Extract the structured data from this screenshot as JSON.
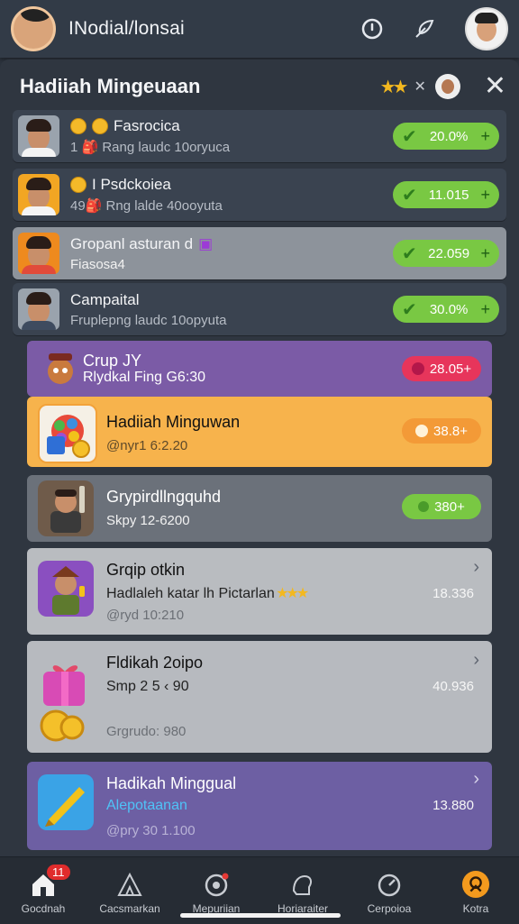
{
  "app": {
    "title": "INodial/lonsai"
  },
  "panel": {
    "title": "Hadiiah Mingeuaan",
    "close_icon": "close-icon"
  },
  "leaderboard": [
    {
      "name": "Fasrocica",
      "sub": "1 🎒 Rang laudc 10oryuca",
      "value": "20.0%",
      "photo_bg": "#9aa3ad",
      "shirt": "#f3f3f3"
    },
    {
      "name": "I Psdckoiea",
      "sub": "49🎒 Rng lalde 40ooyuta",
      "value": "11.015",
      "photo_bg": "#f2a623",
      "shirt": "#ffffff"
    },
    {
      "name": "Gropanl asturan d",
      "sub": "Fiasosa4",
      "value": "22.059",
      "photo_bg": "#ee8a1e",
      "shirt": "#e14b3a"
    },
    {
      "name": "Campaital",
      "sub": "Fruplepng laudc 10opyuta",
      "value": "30.0%",
      "photo_bg": "#9aa3ad",
      "shirt": "#3e4b5f"
    }
  ],
  "cards": [
    {
      "title": "Crup  JY",
      "sub": "Rlydkal Fing G6:30",
      "pill": "28.05+"
    },
    {
      "title": "Hadiiah Minguwan",
      "foot": "@nyr1 6:2.20",
      "pill": "38.8+"
    },
    {
      "title": "Grypirdllngquhd",
      "foot": "Skpy 12-6200",
      "pill": "380+"
    },
    {
      "title": "Grqip  otkin",
      "sub": "Hadlaleh katar lh Pictarlan",
      "foot": "@ryd 10:210",
      "value": "18.336"
    },
    {
      "title": "Fldikah 2oipo",
      "sub": "Smp 2 5 ‹ 90",
      "foot": "Grgrudo: 980",
      "value": "40.936"
    },
    {
      "title": "Hadikah Minggual",
      "sub": "Alepotaanan",
      "foot": "@pry 30 1.100",
      "value": "13.880"
    }
  ],
  "nav": [
    {
      "label": "Gocdnah",
      "icon": "home-icon",
      "badge": "11"
    },
    {
      "label": "Cacsmarkan",
      "icon": "tent-icon"
    },
    {
      "label": "Mepuriian",
      "icon": "gamepad-icon"
    },
    {
      "label": "Horiaraiter",
      "icon": "stack-icon"
    },
    {
      "label": "Cerpoioa",
      "icon": "clock-icon"
    },
    {
      "label": "Kotra",
      "icon": "gift-icon"
    }
  ],
  "colors": {
    "green_pill": "#79c843",
    "purple_card": "#7b5ba6",
    "orange_card": "#f7b34c",
    "red_pill": "#e7355b"
  }
}
